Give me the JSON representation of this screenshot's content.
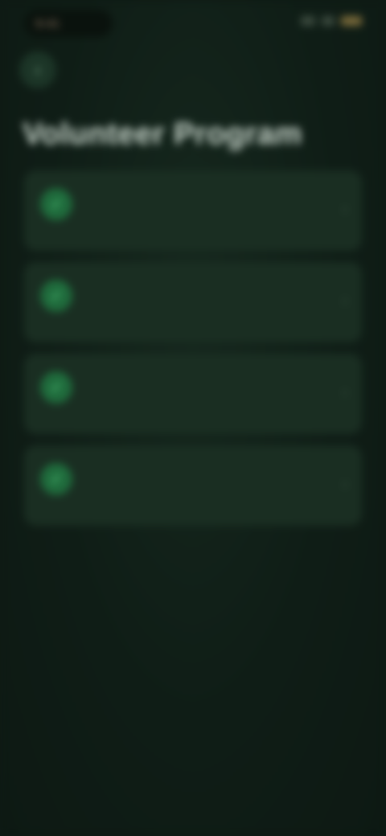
{
  "status_bar": {
    "time": "9:41"
  },
  "header": {
    "back_icon": "back-arrow-icon"
  },
  "page": {
    "title": "Volunteer Program"
  },
  "items": [
    {
      "title": "",
      "subtitle": "",
      "icon": "check-circle-icon"
    },
    {
      "title": "",
      "subtitle": "",
      "icon": "check-circle-icon"
    },
    {
      "title": "",
      "subtitle": "",
      "icon": "check-circle-icon"
    },
    {
      "title": "",
      "subtitle": "",
      "icon": "check-circle-icon"
    }
  ],
  "colors": {
    "background": "#0e1a14",
    "card": "#1a2e22",
    "accent": "#2ecc6a"
  }
}
